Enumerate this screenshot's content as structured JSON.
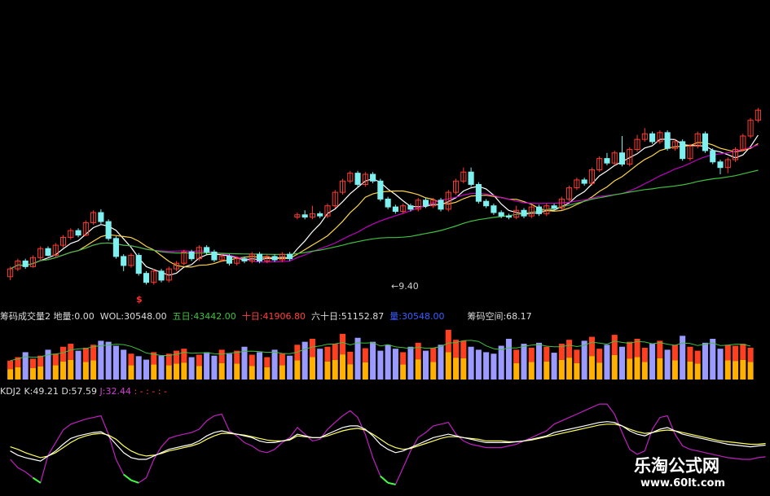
{
  "colors": {
    "background": "#000000",
    "up": "#ff3b30",
    "down": "#7ff0f0",
    "ma5": "#ffffff",
    "ma10": "#ffd54a",
    "ma20": "#c000c0",
    "ma60": "#40c040",
    "price_label": "#cfcfcf",
    "vol_up": "#ff4020",
    "vol_mid": "#ffb000",
    "vol_down": "#9a9aff",
    "k_line": "#ffffff",
    "d_line": "#ffff60",
    "j_line": "#c020c0"
  },
  "price_panel": {
    "low_marker_text": "9.40",
    "signal_mark_text": "$"
  },
  "volume_header": {
    "indicator_name": "筹码成交量2",
    "dilang_label": "地量:",
    "dilang_value": "0.00",
    "wol_label": "WOL:",
    "wol_value": "30548.00",
    "five_label": "五日:",
    "five_value": "43442.00",
    "ten_label": "十日:",
    "ten_value": "41906.80",
    "sixty_label": "六十日:",
    "sixty_value": "51152.87",
    "vol_label": "量:",
    "vol_value": "30548.00",
    "space_label": "筹码空间:",
    "space_value": "68.17"
  },
  "kdj_header": {
    "name": "KDJ2",
    "k_label": "K:",
    "k_value": "49.21",
    "d_label": "D:",
    "d_value": "57.59",
    "j_label": "J:",
    "j_value": "32.44",
    "extra": ": - : - : -"
  },
  "watermark": {
    "title": "乐淘公式网",
    "url": "www.60lt.com"
  },
  "chart_data": {
    "type": "candlestick",
    "candles": [
      [
        0.1,
        0.8,
        -0.2,
        1.0
      ],
      [
        0.8,
        1.5,
        0.6,
        1.7
      ],
      [
        1.5,
        1.0,
        0.8,
        1.7
      ],
      [
        1.0,
        1.8,
        0.9,
        2.0
      ],
      [
        1.8,
        2.6,
        1.6,
        2.8
      ],
      [
        2.6,
        2.0,
        1.9,
        2.8
      ],
      [
        2.0,
        2.9,
        1.8,
        3.1
      ],
      [
        2.9,
        3.6,
        2.7,
        3.8
      ],
      [
        3.6,
        4.2,
        3.4,
        4.4
      ],
      [
        4.2,
        3.8,
        3.6,
        4.4
      ],
      [
        3.8,
        4.9,
        3.7,
        5.1
      ],
      [
        4.9,
        5.8,
        4.7,
        6.0
      ],
      [
        5.8,
        5.0,
        4.8,
        6.1
      ],
      [
        5.0,
        3.5,
        3.3,
        5.2
      ],
      [
        3.5,
        1.9,
        1.7,
        3.7
      ],
      [
        1.9,
        1.1,
        0.6,
        2.1
      ],
      [
        1.1,
        2.0,
        0.9,
        2.2
      ],
      [
        2.0,
        0.4,
        0.2,
        2.2
      ],
      [
        0.4,
        -0.4,
        -0.6,
        0.6
      ],
      [
        -0.4,
        0.6,
        -0.6,
        0.8
      ],
      [
        0.6,
        -0.2,
        -0.4,
        0.8
      ],
      [
        -0.2,
        0.8,
        -0.4,
        1.0
      ],
      [
        0.8,
        1.3,
        0.6,
        1.5
      ],
      [
        1.3,
        2.3,
        1.1,
        2.5
      ],
      [
        2.3,
        1.7,
        1.5,
        2.5
      ],
      [
        1.7,
        2.7,
        1.5,
        2.9
      ],
      [
        2.7,
        2.3,
        2.1,
        2.9
      ],
      [
        2.3,
        1.6,
        1.4,
        2.5
      ],
      [
        1.6,
        1.9,
        1.4,
        2.1
      ],
      [
        1.9,
        1.3,
        1.1,
        2.1
      ],
      [
        1.3,
        1.7,
        1.1,
        1.9
      ],
      [
        1.7,
        1.5,
        1.3,
        1.9
      ],
      [
        1.5,
        2.1,
        1.3,
        2.3
      ],
      [
        2.1,
        1.5,
        1.3,
        2.3
      ],
      [
        1.5,
        1.9,
        1.3,
        2.1
      ],
      [
        1.9,
        1.6,
        1.4,
        2.1
      ],
      [
        1.6,
        2.1,
        1.4,
        2.3
      ],
      [
        2.1,
        1.7,
        1.5,
        2.3
      ],
      [
        5.4,
        5.6,
        5.2,
        5.8
      ],
      [
        5.6,
        5.4,
        5.2,
        6.0
      ],
      [
        5.4,
        5.7,
        5.2,
        6.4
      ],
      [
        5.7,
        5.5,
        5.3,
        5.9
      ],
      [
        5.5,
        6.4,
        5.3,
        6.6
      ],
      [
        6.4,
        7.6,
        6.2,
        7.8
      ],
      [
        7.6,
        8.6,
        7.4,
        8.8
      ],
      [
        8.6,
        9.3,
        8.4,
        9.5
      ],
      [
        9.3,
        8.3,
        8.1,
        9.5
      ],
      [
        8.3,
        9.2,
        8.1,
        9.4
      ],
      [
        9.2,
        8.6,
        8.4,
        9.4
      ],
      [
        8.6,
        7.0,
        6.8,
        8.8
      ],
      [
        7.0,
        6.3,
        6.1,
        7.2
      ],
      [
        6.3,
        5.9,
        5.7,
        6.5
      ],
      [
        5.9,
        6.4,
        5.7,
        6.6
      ],
      [
        6.4,
        6.1,
        5.9,
        6.6
      ],
      [
        6.1,
        6.9,
        5.9,
        7.1
      ],
      [
        6.9,
        6.4,
        6.2,
        7.1
      ],
      [
        6.4,
        6.9,
        6.2,
        7.1
      ],
      [
        6.9,
        6.1,
        5.9,
        7.1
      ],
      [
        6.1,
        7.6,
        5.9,
        7.8
      ],
      [
        7.6,
        8.6,
        7.4,
        8.8
      ],
      [
        8.6,
        9.4,
        8.4,
        9.8
      ],
      [
        9.4,
        8.3,
        8.1,
        9.8
      ],
      [
        8.3,
        6.8,
        6.6,
        8.5
      ],
      [
        6.8,
        6.4,
        6.2,
        7.0
      ],
      [
        6.4,
        5.8,
        5.6,
        6.6
      ],
      [
        5.8,
        5.5,
        5.3,
        6.0
      ],
      [
        5.5,
        5.4,
        5.2,
        5.7
      ],
      [
        5.4,
        6.0,
        5.2,
        6.4
      ],
      [
        6.0,
        5.5,
        5.3,
        6.2
      ],
      [
        5.5,
        6.3,
        5.3,
        6.5
      ],
      [
        6.3,
        5.7,
        5.5,
        6.5
      ],
      [
        5.7,
        6.4,
        5.5,
        6.6
      ],
      [
        6.4,
        6.2,
        6.0,
        6.6
      ],
      [
        6.2,
        7.0,
        6.0,
        7.2
      ],
      [
        7.0,
        8.0,
        6.8,
        8.2
      ],
      [
        8.0,
        8.7,
        7.8,
        8.9
      ],
      [
        8.7,
        8.4,
        8.2,
        8.9
      ],
      [
        8.4,
        9.6,
        8.2,
        9.8
      ],
      [
        9.6,
        10.6,
        9.4,
        10.8
      ],
      [
        10.6,
        10.2,
        10.0,
        11.1
      ],
      [
        10.2,
        11.1,
        10.0,
        11.3
      ],
      [
        11.1,
        10.1,
        9.9,
        12.6
      ],
      [
        10.1,
        11.4,
        9.9,
        11.6
      ],
      [
        11.4,
        12.3,
        11.2,
        12.7
      ],
      [
        12.3,
        12.8,
        12.1,
        13.3
      ],
      [
        12.8,
        12.1,
        11.9,
        13.0
      ],
      [
        12.1,
        12.9,
        11.9,
        13.1
      ],
      [
        12.9,
        11.5,
        11.3,
        13.1
      ],
      [
        11.5,
        12.1,
        11.3,
        12.3
      ],
      [
        12.1,
        10.6,
        10.4,
        12.3
      ],
      [
        10.6,
        11.7,
        10.4,
        11.9
      ],
      [
        11.7,
        12.8,
        11.5,
        13.0
      ],
      [
        12.8,
        11.3,
        11.1,
        13.0
      ],
      [
        11.3,
        10.3,
        10.1,
        11.5
      ],
      [
        10.3,
        9.8,
        9.2,
        10.5
      ],
      [
        9.8,
        10.5,
        9.3,
        10.7
      ],
      [
        10.5,
        11.4,
        10.3,
        11.6
      ],
      [
        11.4,
        12.6,
        11.2,
        12.8
      ],
      [
        12.6,
        14.0,
        12.4,
        14.2
      ],
      [
        14.0,
        14.9,
        13.8,
        15.1
      ]
    ],
    "volume": [
      38,
      45,
      55,
      42,
      48,
      60,
      52,
      66,
      72,
      58,
      64,
      70,
      78,
      76,
      68,
      60,
      52,
      47,
      40,
      55,
      48,
      52,
      58,
      62,
      45,
      50,
      55,
      48,
      60,
      52,
      58,
      66,
      50,
      55,
      45,
      60,
      52,
      48,
      70,
      76,
      82,
      62,
      66,
      72,
      92,
      56,
      84,
      63,
      76,
      58,
      70,
      62,
      55,
      66,
      74,
      58,
      64,
      70,
      100,
      80,
      78,
      66,
      60,
      55,
      52,
      68,
      82,
      60,
      72,
      64,
      74,
      66,
      54,
      72,
      80,
      60,
      78,
      86,
      62,
      70,
      90,
      66,
      76,
      82,
      64,
      72,
      78,
      60,
      70,
      88,
      66,
      58,
      74,
      82,
      62,
      70,
      68,
      72,
      64
    ],
    "kdj": {
      "k": [
        40,
        35,
        32,
        30,
        28,
        34,
        40,
        48,
        55,
        58,
        60,
        62,
        63,
        58,
        48,
        38,
        32,
        30,
        30,
        34,
        38,
        42,
        44,
        46,
        48,
        52,
        58,
        62,
        64,
        62,
        60,
        58,
        56,
        52,
        50,
        50,
        52,
        54,
        60,
        58,
        56,
        56,
        60,
        64,
        68,
        70,
        70,
        66,
        58,
        48,
        42,
        38,
        40,
        44,
        48,
        52,
        56,
        58,
        60,
        58,
        56,
        54,
        52,
        50,
        50,
        50,
        50,
        51,
        52,
        54,
        56,
        58,
        62,
        64,
        66,
        68,
        70,
        72,
        74,
        75,
        74,
        70,
        64,
        60,
        58,
        62,
        66,
        68,
        64,
        60,
        58,
        56,
        54,
        52,
        50,
        48,
        47,
        46,
        45,
        46,
        47
      ],
      "d": [
        45,
        42,
        38,
        35,
        32,
        34,
        38,
        44,
        50,
        55,
        58,
        60,
        61,
        59,
        54,
        46,
        40,
        36,
        34,
        35,
        37,
        40,
        42,
        44,
        46,
        49,
        54,
        58,
        61,
        61,
        60,
        59,
        57,
        55,
        53,
        52,
        52,
        53,
        58,
        57,
        56,
        56,
        58,
        61,
        64,
        66,
        67,
        65,
        60,
        54,
        48,
        44,
        42,
        43,
        46,
        49,
        52,
        55,
        57,
        57,
        56,
        55,
        54,
        52,
        52,
        52,
        51,
        51,
        52,
        53,
        55,
        57,
        59,
        61,
        63,
        65,
        67,
        69,
        71,
        72,
        72,
        70,
        66,
        63,
        61,
        62,
        64,
        65,
        64,
        62,
        60,
        58,
        56,
        54,
        52,
        51,
        50,
        49,
        48,
        48,
        49
      ],
      "j": [
        30,
        20,
        15,
        8,
        2,
        35,
        50,
        65,
        72,
        75,
        78,
        80,
        82,
        60,
        30,
        12,
        5,
        2,
        8,
        30,
        45,
        55,
        58,
        60,
        62,
        66,
        76,
        82,
        84,
        64,
        58,
        50,
        46,
        40,
        38,
        42,
        50,
        56,
        68,
        60,
        52,
        54,
        66,
        74,
        82,
        88,
        80,
        60,
        32,
        10,
        2,
        0,
        20,
        40,
        56,
        62,
        70,
        72,
        74,
        60,
        52,
        48,
        46,
        44,
        44,
        44,
        46,
        48,
        52,
        56,
        60,
        64,
        72,
        76,
        80,
        84,
        88,
        92,
        96,
        96,
        84,
        62,
        42,
        36,
        40,
        66,
        80,
        82,
        60,
        46,
        42,
        40,
        38,
        36,
        34,
        32,
        31,
        30,
        30,
        32,
        33
      ]
    }
  }
}
